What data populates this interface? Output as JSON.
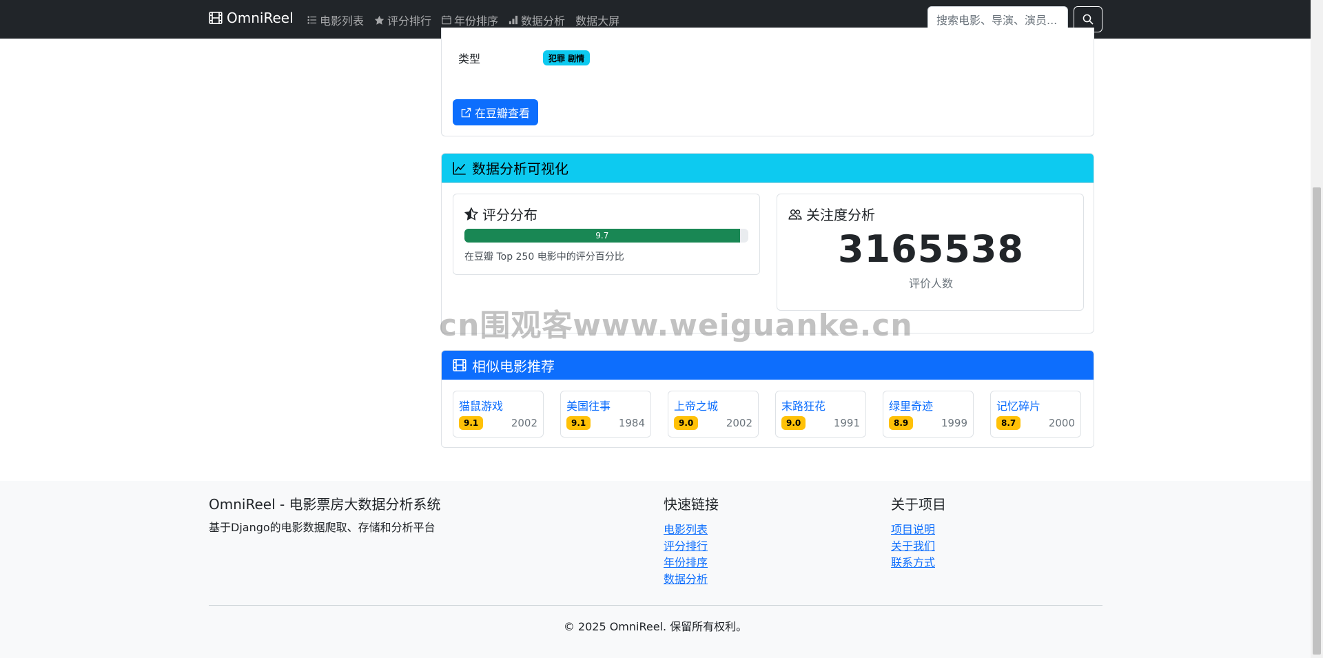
{
  "navbar": {
    "brand": "OmniReel",
    "links": [
      {
        "label": "电影列表",
        "icon": "list-icon"
      },
      {
        "label": "评分排行",
        "icon": "star-icon"
      },
      {
        "label": "年份排序",
        "icon": "calendar-icon"
      },
      {
        "label": "数据分析",
        "icon": "bar-chart-icon"
      },
      {
        "label": "数据大屏",
        "icon": ""
      }
    ],
    "search_placeholder": "搜索电影、导演、演员..."
  },
  "movie_info": {
    "genre_label": "类型",
    "genre_value": "犯罪 剧情",
    "douban_button": "在豆瓣查看"
  },
  "analysis": {
    "header": "数据分析可视化",
    "rating": {
      "title": "评分分布",
      "value_label": "9.7",
      "progress_fraction": 0.97,
      "note": "在豆瓣 Top 250 电影中的评分百分比"
    },
    "attention": {
      "title": "关注度分析",
      "number": "3165538",
      "label": "评价人数"
    }
  },
  "similar": {
    "header": "相似电影推荐",
    "movies": [
      {
        "title": "猫鼠游戏",
        "rating": "9.1",
        "year": "2002"
      },
      {
        "title": "美国往事",
        "rating": "9.1",
        "year": "1984"
      },
      {
        "title": "上帝之城",
        "rating": "9.0",
        "year": "2002"
      },
      {
        "title": "末路狂花",
        "rating": "9.0",
        "year": "1991"
      },
      {
        "title": "绿里奇迹",
        "rating": "8.9",
        "year": "1999"
      },
      {
        "title": "记忆碎片",
        "rating": "8.7",
        "year": "2000"
      }
    ]
  },
  "watermark": "cn围观客www.weiguanke.cn",
  "footer": {
    "title": "OmniReel - 电影票房大数据分析系统",
    "description": "基于Django的电影数据爬取、存储和分析平台",
    "quick_links_title": "快速链接",
    "quick_links": [
      "电影列表",
      "评分排行",
      "年份排序",
      "数据分析"
    ],
    "about_title": "关于项目",
    "about_links": [
      "项目说明",
      "关于我们",
      "联系方式"
    ],
    "copyright": "© 2025 OmniReel. 保留所有权利。"
  },
  "colors": {
    "navbar_bg": "#212529",
    "primary": "#0d6efd",
    "info": "#0dcaf0",
    "success": "#198754",
    "warning": "#ffc107"
  }
}
